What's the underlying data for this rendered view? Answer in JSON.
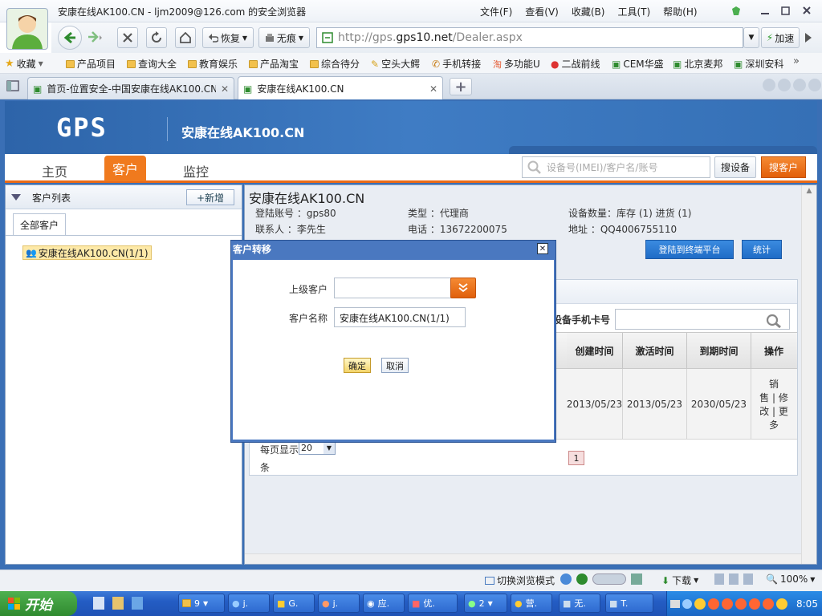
{
  "window": {
    "title": "安康在线AK100.CN - ljm2009@126.com 的安全浏览器"
  },
  "menu": [
    "文件(F)",
    "查看(V)",
    "收藏(B)",
    "工具(T)",
    "帮助(H)"
  ],
  "nav": {
    "restore": "恢复",
    "notrace": "无痕",
    "url_prefix": "http://gps.",
    "url_host": "gps10.net",
    "url_path": "/Dealer.aspx",
    "accelerate": "加速"
  },
  "bookmarks": {
    "favorites": "收藏",
    "items": [
      "产品项目",
      "查询大全",
      "教育娱乐",
      "产品淘宝",
      "综合待分",
      "空头大鳄",
      "手机转接",
      "多功能U",
      "二战前线",
      "CEM华盛",
      "北京麦邦",
      "深圳安科"
    ],
    "more": "»"
  },
  "tabs": [
    {
      "label": "首页-位置安全-中国安康在线AK100.CN"
    },
    {
      "label": "安康在线AK100.CN"
    }
  ],
  "tabbar": {
    "add": "+"
  },
  "app": {
    "logo": "GPS",
    "site_title": "安康在线AK100.CN",
    "search_placeholder": "设备号(IMEI)/客户名/账号",
    "btn_search_device": "搜设备",
    "btn_search_customer": "搜客户"
  },
  "mainnav": [
    "主页",
    "客户",
    "监控"
  ],
  "left": {
    "title": "客户列表",
    "add": "+新增",
    "tab_all": "全部客户",
    "tree_item": "安康在线AK100.CN(1/1)"
  },
  "right": {
    "company": "安康在线AK100.CN",
    "info": [
      {
        "label": "登陆账号",
        "value": "gps80"
      },
      {
        "label": "类型",
        "value": "代理商"
      },
      {
        "label": "设备数量",
        "value": "库存 (1) 进货 (1)"
      },
      {
        "label": "联系人",
        "value": "李先生"
      },
      {
        "label": "电话",
        "value": "13672200075"
      },
      {
        "label": "地址",
        "value": "QQ4006755110"
      }
    ],
    "btn_login": "登陆到终端平台",
    "btn_stats": "统计",
    "sim_label": "设备手机卡号",
    "headers": [
      "创建时间",
      "激活时间",
      "到期时间",
      "操作"
    ],
    "row": {
      "created": "2013/05/23",
      "activated": "2013/05/23",
      "expire": "2030/05/23",
      "ops": [
        "销",
        "售 | 修",
        "改 | 更",
        "多"
      ]
    },
    "perpage_label": "每页显示",
    "perpage_value": "20",
    "perpage_unit": "条",
    "page": "1"
  },
  "dialog": {
    "title": "客户转移",
    "parent_label": "上级客户",
    "parent_value": "",
    "name_label": "客户名称",
    "name_value": "安康在线AK100.CN(1/1)",
    "ok": "确定",
    "cancel": "取消"
  },
  "status": {
    "switch_mode": "切换浏览模式",
    "download": "下载",
    "zoom": "100%"
  },
  "taskbar": {
    "start": "开始",
    "items": [
      "9",
      "j.",
      "G.",
      "j.",
      "应.",
      "优.",
      "2",
      "营.",
      "无.",
      "T."
    ],
    "clock": "8:05"
  }
}
